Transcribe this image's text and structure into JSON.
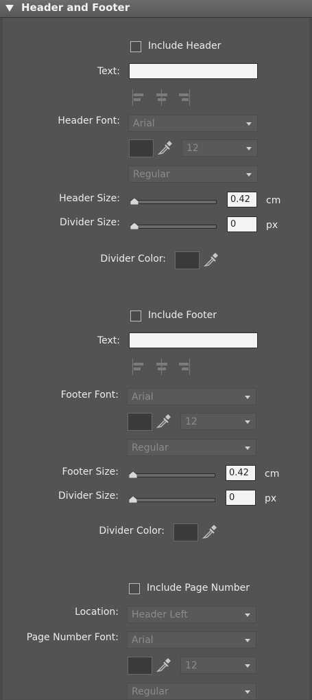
{
  "section_title": "Header and Footer",
  "header": {
    "include_label": "Include Header",
    "text_label": "Text:",
    "text_value": "",
    "font_label": "Header Font:",
    "font_value": "Arial",
    "font_size": "12",
    "font_style": "Regular",
    "size_label": "Header Size:",
    "size_value": "0.42",
    "size_unit": "cm",
    "divider_size_label": "Divider Size:",
    "divider_size_value": "0",
    "divider_size_unit": "px",
    "divider_color_label": "Divider Color:"
  },
  "footer": {
    "include_label": "Include Footer",
    "text_label": "Text:",
    "text_value": "",
    "font_label": "Footer Font:",
    "font_value": "Arial",
    "font_size": "12",
    "font_style": "Regular",
    "size_label": "Footer Size:",
    "size_value": "0.42",
    "size_unit": "cm",
    "divider_size_label": "Divider Size:",
    "divider_size_value": "0",
    "divider_size_unit": "px",
    "divider_color_label": "Divider Color:"
  },
  "page_number": {
    "include_label": "Include Page Number",
    "location_label": "Location:",
    "location_value": "Header Left",
    "font_label": "Page Number Font:",
    "font_value": "Arial",
    "font_size": "12",
    "font_style": "Regular"
  },
  "colors": {
    "panel_bg": "#535353",
    "swatch": "#3a3a3a",
    "textbox": "#f3f3f3"
  }
}
